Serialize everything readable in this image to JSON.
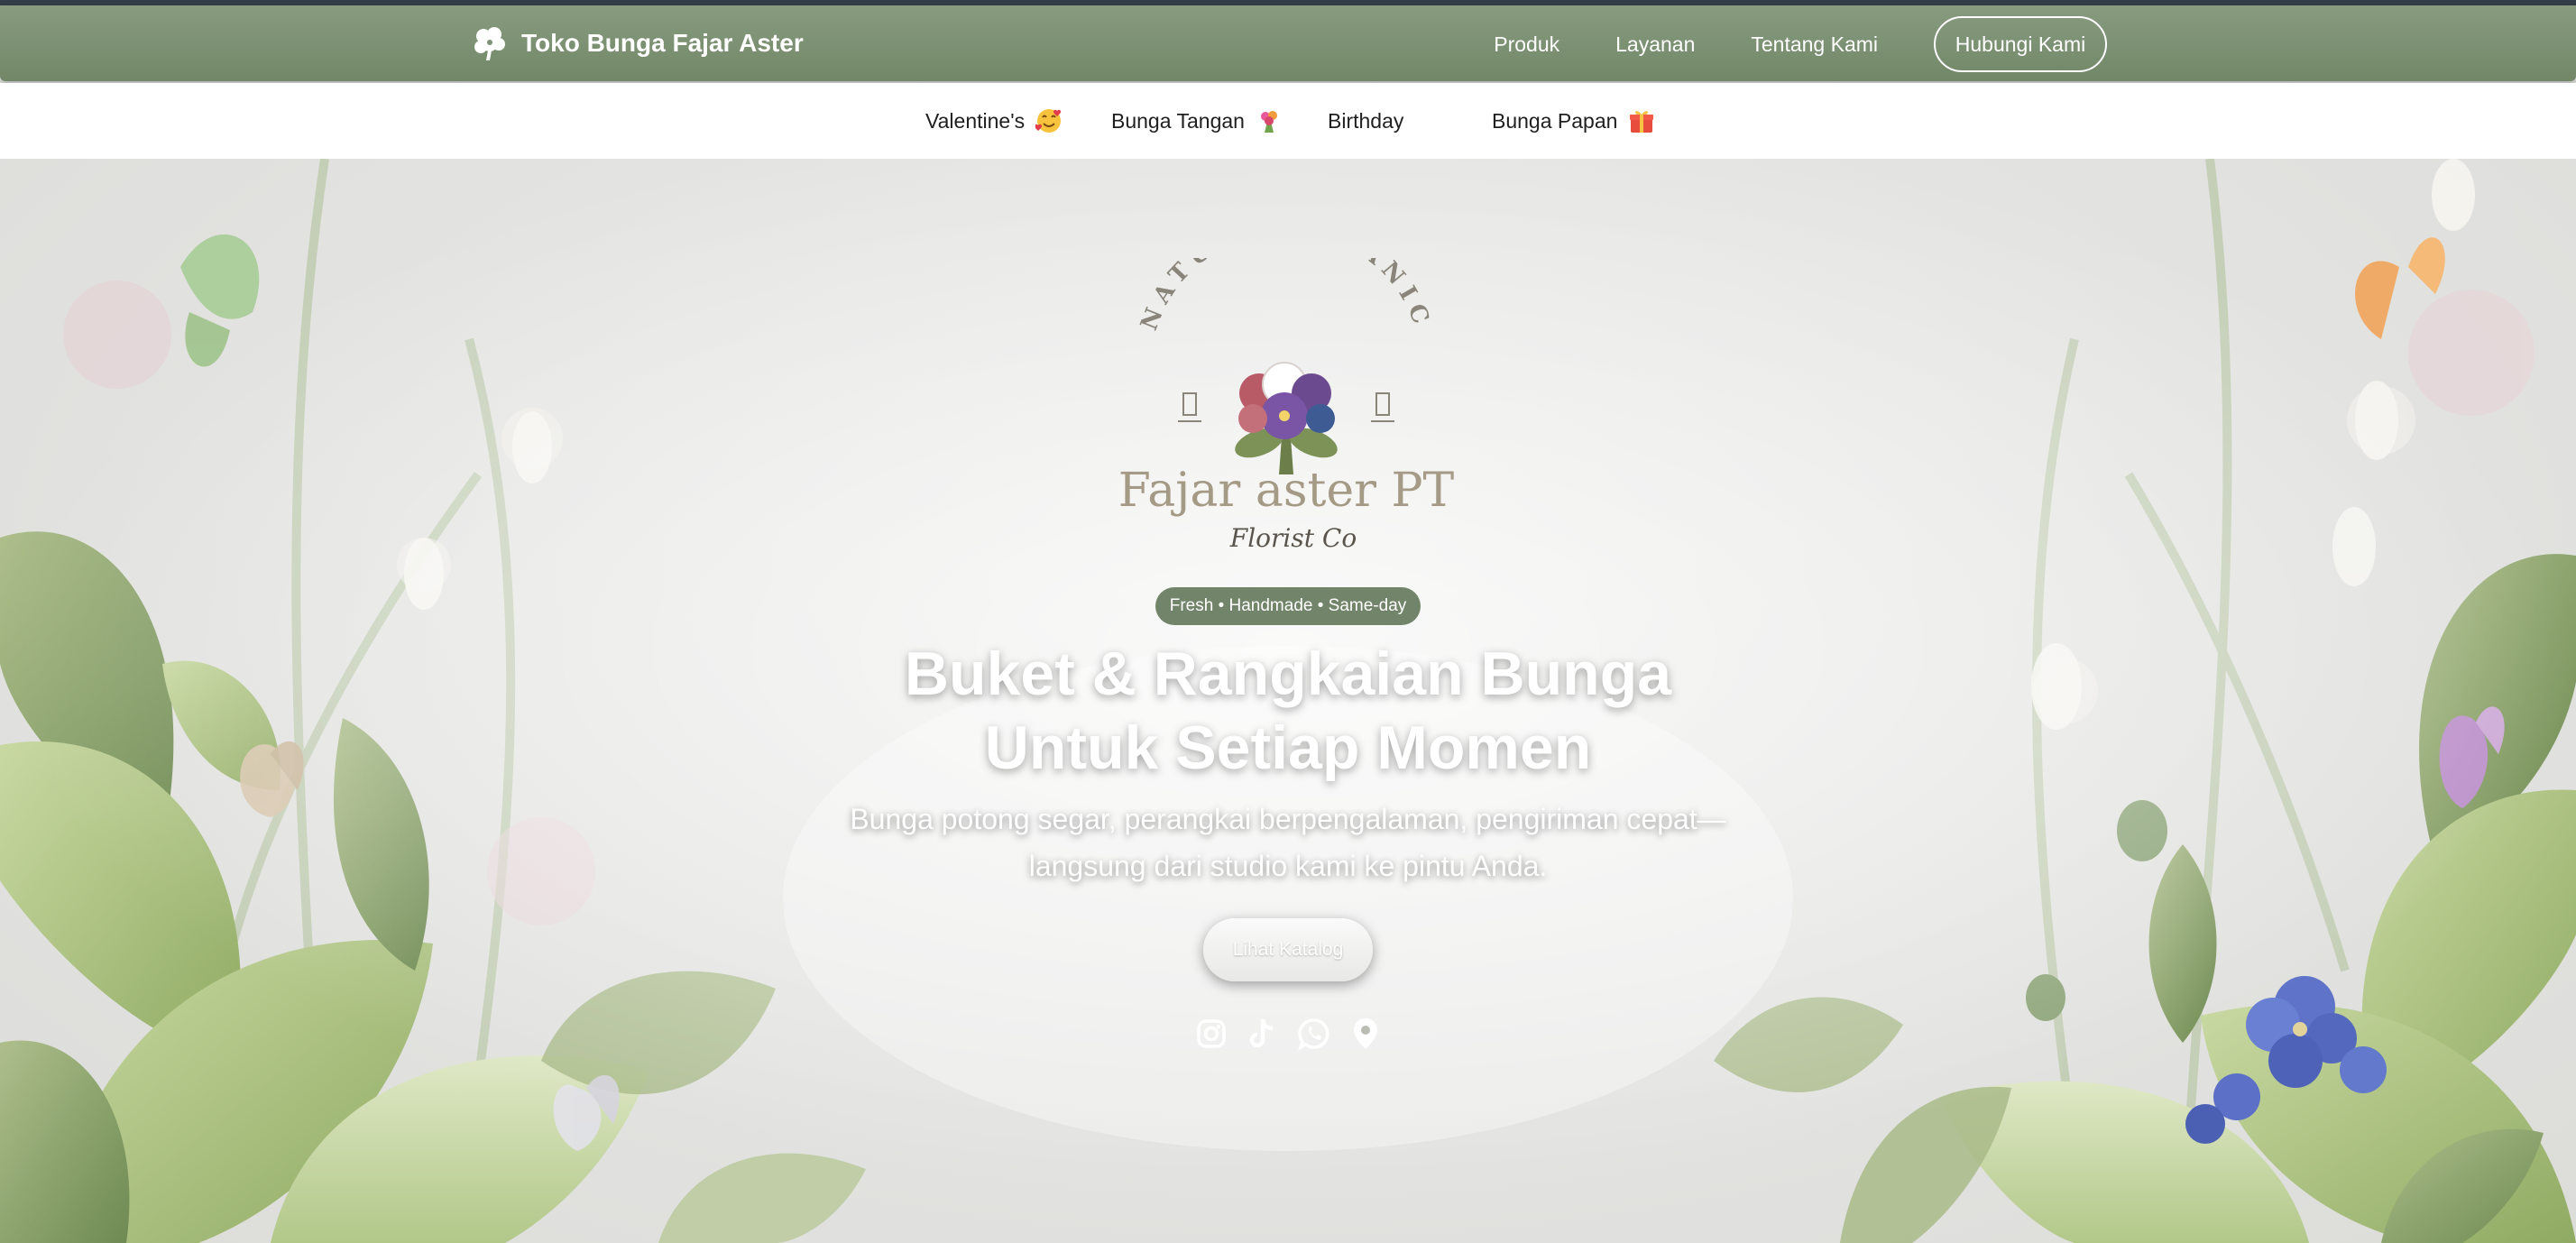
{
  "navbar": {
    "brand": "Toko Bunga Fajar Aster",
    "brand_icon": "flower-icon",
    "links": [
      "Produk",
      "Layanan",
      "Tentang Kami"
    ],
    "cta": "Hubungi Kami"
  },
  "subnav": {
    "items": [
      {
        "label": "Valentine's",
        "icon": "smiling-face-with-hearts-emoji"
      },
      {
        "label": "Bunga Tangan",
        "icon": "bouquet-emoji"
      },
      {
        "label": "Birthday",
        "icon": ""
      },
      {
        "label": "Bunga Papan",
        "icon": "gift-emoji"
      }
    ]
  },
  "hero": {
    "logo": {
      "arc_text": "NATURE ORGANIC",
      "name": "Fajar aster PT",
      "script": "Florist Co"
    },
    "badge": "Fresh • Handmade • Same-day",
    "title_line1": "Buket & Rangkaian Bunga",
    "title_line2": "Untuk Setiap Momen",
    "subtitle_line1": "Bunga potong segar, perangkai berpengalaman, pengiriman cepat—",
    "subtitle_line2": "langsung dari studio kami ke pintu Anda.",
    "cta": "Lihat Katalog",
    "socials": [
      "instagram-icon",
      "tiktok-icon",
      "whatsapp-icon",
      "location-pin-icon"
    ]
  },
  "colors": {
    "navbar": "#7d9173",
    "badge": "#72856a",
    "topline": "#343d4a",
    "hero_bg": "#e3e3e1"
  }
}
